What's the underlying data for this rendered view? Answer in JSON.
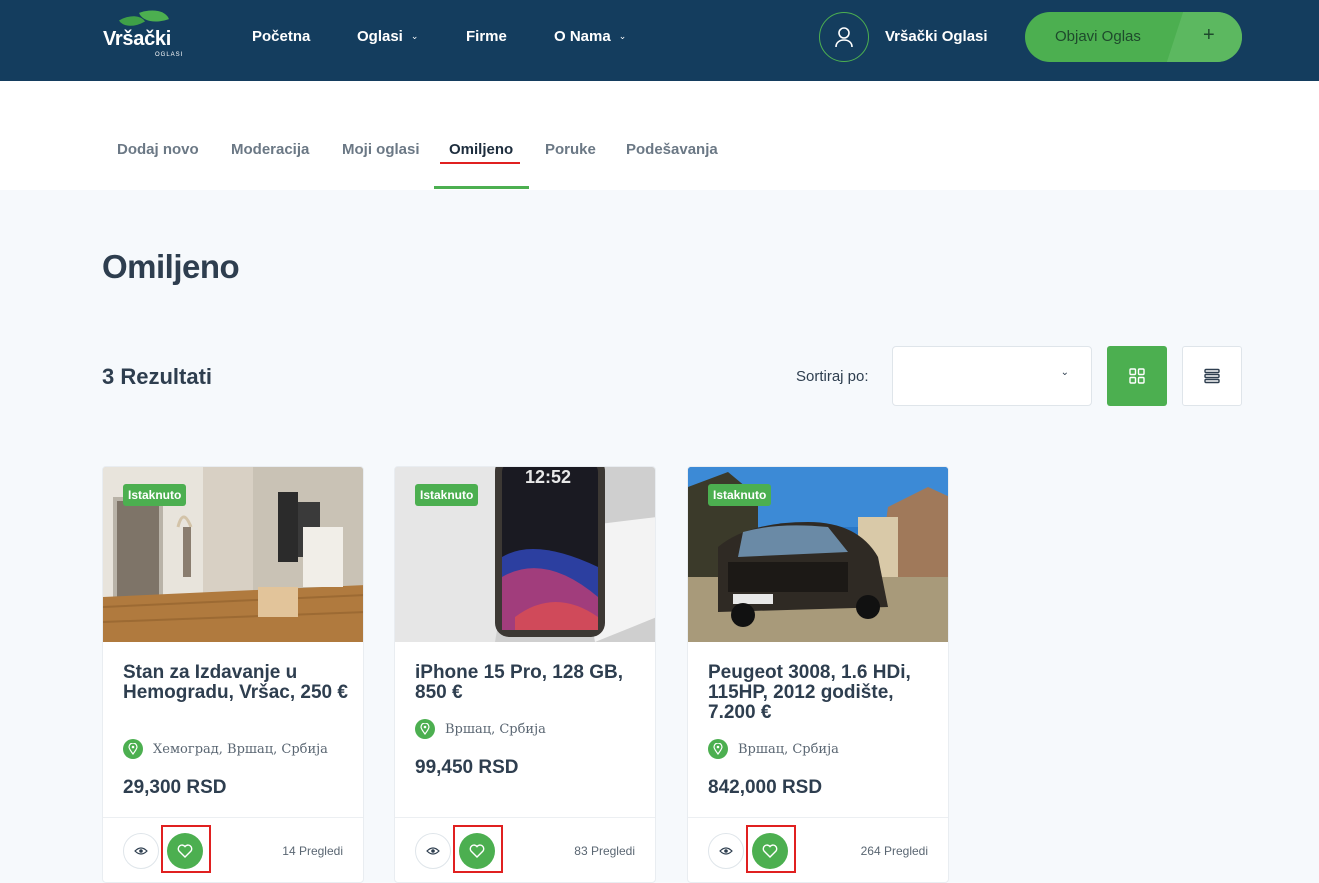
{
  "header": {
    "logo_text": "Vršački",
    "logo_sub": "OGLASI",
    "nav": [
      {
        "label": "Početna"
      },
      {
        "label": "Oglasi"
      },
      {
        "label": "Firme"
      },
      {
        "label": "O Nama"
      }
    ],
    "user_name": "Vršački Oglasi",
    "post_button": "Objavi Oglas",
    "post_plus": "+"
  },
  "tabs": [
    {
      "label": "Dodaj novo"
    },
    {
      "label": "Moderacija"
    },
    {
      "label": "Moji oglasi"
    },
    {
      "label": "Omiljeno",
      "active": true
    },
    {
      "label": "Poruke"
    },
    {
      "label": "Podešavanja"
    }
  ],
  "page_title": "Omiljeno",
  "results_label": "3 Rezultati",
  "sort": {
    "label": "Sortiraj po:",
    "value": ""
  },
  "cards": [
    {
      "badge": "Istaknuto",
      "title": "Stan za Izdavanje u Hemogradu, Vršac, 250 €",
      "location": "Хемоград, Вршац, Србија",
      "price": "29,300 RSD",
      "views": "14 Pregledi"
    },
    {
      "badge": "Istaknuto",
      "title": "iPhone 15 Pro, 128 GB, 850 €",
      "location": "Вршац, Србија",
      "price": "99,450 RSD",
      "views": "83 Pregledi",
      "phone_time": "12:52"
    },
    {
      "badge": "Istaknuto",
      "title": "Peugeot 3008, 1.6 HDi, 115HP, 2012 godište, 7.200 €",
      "location": "Вршац, Србија",
      "price": "842,000 RSD",
      "views": "264 Pregledi"
    }
  ]
}
